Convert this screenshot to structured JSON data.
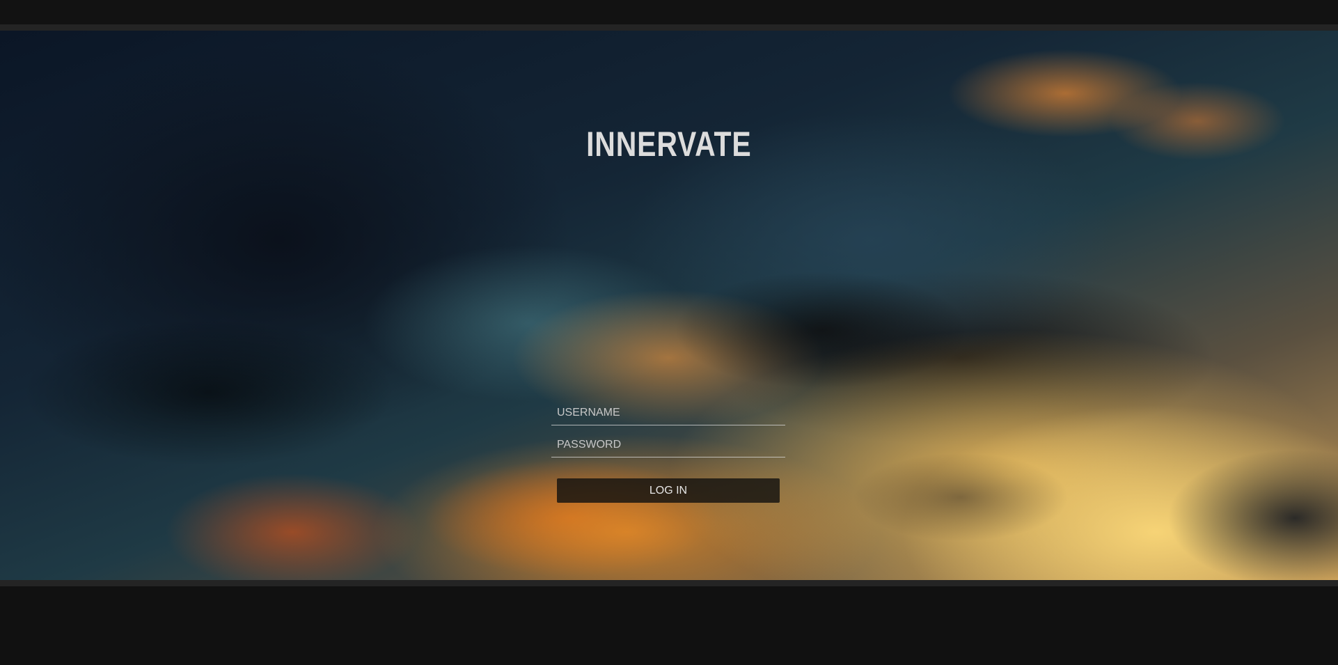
{
  "brand": {
    "logo_text": "INNERVATE"
  },
  "login": {
    "username_placeholder": "USERNAME",
    "username_value": "",
    "password_placeholder": "PASSWORD",
    "password_value": "",
    "submit_label": "LOG IN"
  },
  "colors": {
    "page_background": "#111111",
    "strip": "#242424",
    "logo_text": "#dcdcdc",
    "button_background": "#141210"
  }
}
